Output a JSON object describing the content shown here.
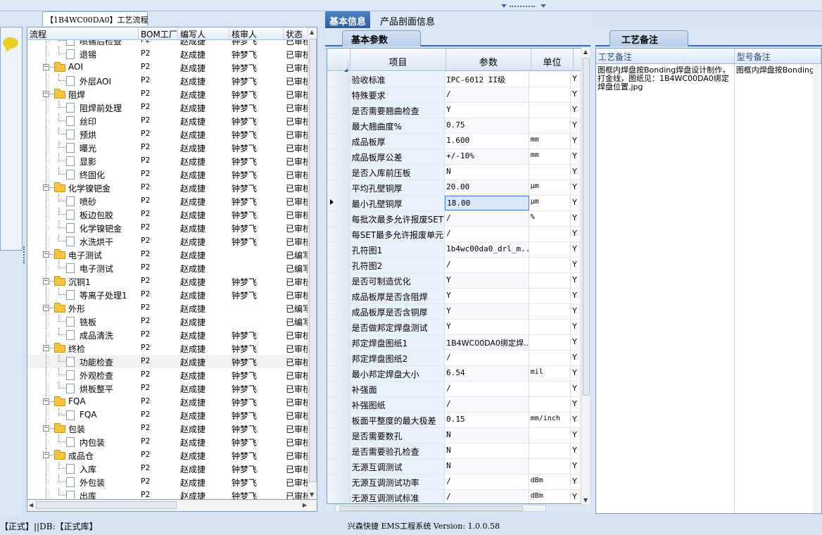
{
  "left_panel": {
    "tab_title": "【1B4WC00DA0】工艺流程",
    "columns": [
      "流程",
      "BOM工厂",
      "编写人",
      "核审人",
      "状态"
    ],
    "rows": [
      {
        "level": 2,
        "type": "item",
        "name": "喷锡后检查",
        "bom": "P2",
        "writer": "赵成捷",
        "reviewer": "钟梦飞",
        "status": "已审核",
        "partial": true
      },
      {
        "level": 2,
        "type": "item",
        "name": "退锡",
        "bom": "P2",
        "writer": "赵成捷",
        "reviewer": "钟梦飞",
        "status": "已审核"
      },
      {
        "level": 1,
        "type": "group",
        "name": "AOI",
        "bom": "P2",
        "writer": "赵成捷",
        "reviewer": "钟梦飞",
        "status": "已审核"
      },
      {
        "level": 2,
        "type": "item",
        "name": "外层AOI",
        "bom": "P2",
        "writer": "赵成捷",
        "reviewer": "钟梦飞",
        "status": "已审核"
      },
      {
        "level": 1,
        "type": "group",
        "name": "阻焊",
        "bom": "P2",
        "writer": "赵成捷",
        "reviewer": "钟梦飞",
        "status": "已审核"
      },
      {
        "level": 2,
        "type": "item",
        "name": "阻焊前处理",
        "bom": "P2",
        "writer": "赵成捷",
        "reviewer": "钟梦飞",
        "status": "已审核"
      },
      {
        "level": 2,
        "type": "item",
        "name": "丝印",
        "bom": "P2",
        "writer": "赵成捷",
        "reviewer": "钟梦飞",
        "status": "已审核"
      },
      {
        "level": 2,
        "type": "item",
        "name": "预烘",
        "bom": "P2",
        "writer": "赵成捷",
        "reviewer": "钟梦飞",
        "status": "已审核"
      },
      {
        "level": 2,
        "type": "item",
        "name": "曝光",
        "bom": "P2",
        "writer": "赵成捷",
        "reviewer": "钟梦飞",
        "status": "已审核"
      },
      {
        "level": 2,
        "type": "item",
        "name": "显影",
        "bom": "P2",
        "writer": "赵成捷",
        "reviewer": "钟梦飞",
        "status": "已审核"
      },
      {
        "level": 2,
        "type": "item",
        "name": "终固化",
        "bom": "P2",
        "writer": "赵成捷",
        "reviewer": "钟梦飞",
        "status": "已审核"
      },
      {
        "level": 1,
        "type": "group",
        "name": "化学镍钯金",
        "bom": "P2",
        "writer": "赵成捷",
        "reviewer": "钟梦飞",
        "status": "已审核"
      },
      {
        "level": 2,
        "type": "item",
        "name": "喷砂",
        "bom": "P2",
        "writer": "赵成捷",
        "reviewer": "钟梦飞",
        "status": "已审核"
      },
      {
        "level": 2,
        "type": "item",
        "name": "板边包胶",
        "bom": "P2",
        "writer": "赵成捷",
        "reviewer": "钟梦飞",
        "status": "已审核"
      },
      {
        "level": 2,
        "type": "item",
        "name": "化学镍钯金",
        "bom": "P2",
        "writer": "赵成捷",
        "reviewer": "钟梦飞",
        "status": "已审核"
      },
      {
        "level": 2,
        "type": "item",
        "name": "水洗烘干",
        "bom": "P2",
        "writer": "赵成捷",
        "reviewer": "钟梦飞",
        "status": "已审核"
      },
      {
        "level": 1,
        "type": "group",
        "name": "电子测试",
        "bom": "P2",
        "writer": "赵成捷",
        "reviewer": "",
        "status": "已编写"
      },
      {
        "level": 2,
        "type": "item",
        "name": "电子测试",
        "bom": "P2",
        "writer": "赵成捷",
        "reviewer": "",
        "status": "已编写"
      },
      {
        "level": 1,
        "type": "group",
        "name": "沉铜1",
        "bom": "P2",
        "writer": "赵成捷",
        "reviewer": "钟梦飞",
        "status": "已审核"
      },
      {
        "level": 2,
        "type": "item",
        "name": "等离子处理1",
        "bom": "P2",
        "writer": "赵成捷",
        "reviewer": "钟梦飞",
        "status": "已审核"
      },
      {
        "level": 1,
        "type": "group",
        "name": "外形",
        "bom": "P2",
        "writer": "赵成捷",
        "reviewer": "",
        "status": "已编写"
      },
      {
        "level": 2,
        "type": "item",
        "name": "铣板",
        "bom": "P2",
        "writer": "赵成捷",
        "reviewer": "",
        "status": "已编写"
      },
      {
        "level": 2,
        "type": "item",
        "name": "成品清洗",
        "bom": "P2",
        "writer": "赵成捷",
        "reviewer": "钟梦飞",
        "status": "已审核"
      },
      {
        "level": 1,
        "type": "group",
        "name": "终检",
        "bom": "P2",
        "writer": "赵成捷",
        "reviewer": "钟梦飞",
        "status": "已审核"
      },
      {
        "level": 2,
        "type": "item",
        "name": "功能检查",
        "bom": "P2",
        "writer": "赵成捷",
        "reviewer": "钟梦飞",
        "status": "已审核",
        "selected": true
      },
      {
        "level": 2,
        "type": "item",
        "name": "外观检查",
        "bom": "P2",
        "writer": "赵成捷",
        "reviewer": "钟梦飞",
        "status": "已审核"
      },
      {
        "level": 2,
        "type": "item",
        "name": "烘板整平",
        "bom": "P2",
        "writer": "赵成捷",
        "reviewer": "钟梦飞",
        "status": "已审核"
      },
      {
        "level": 1,
        "type": "group",
        "name": "FQA",
        "bom": "P2",
        "writer": "赵成捷",
        "reviewer": "钟梦飞",
        "status": "已审核"
      },
      {
        "level": 2,
        "type": "item",
        "name": "FQA",
        "bom": "P2",
        "writer": "赵成捷",
        "reviewer": "钟梦飞",
        "status": "已审核"
      },
      {
        "level": 1,
        "type": "group",
        "name": "包装",
        "bom": "P2",
        "writer": "赵成捷",
        "reviewer": "钟梦飞",
        "status": "已审核"
      },
      {
        "level": 2,
        "type": "item",
        "name": "内包装",
        "bom": "P2",
        "writer": "赵成捷",
        "reviewer": "钟梦飞",
        "status": "已审核"
      },
      {
        "level": 1,
        "type": "group",
        "name": "成品仓",
        "bom": "P2",
        "writer": "赵成捷",
        "reviewer": "钟梦飞",
        "status": "已审核"
      },
      {
        "level": 2,
        "type": "item",
        "name": "入库",
        "bom": "P2",
        "writer": "赵成捷",
        "reviewer": "钟梦飞",
        "status": "已审核"
      },
      {
        "level": 2,
        "type": "item",
        "name": "外包装",
        "bom": "P2",
        "writer": "赵成捷",
        "reviewer": "钟梦飞",
        "status": "已审核"
      },
      {
        "level": 2,
        "type": "item",
        "name": "出库",
        "bom": "P2",
        "writer": "赵成捷",
        "reviewer": "钟梦飞",
        "status": "已审核"
      }
    ]
  },
  "middle_panel": {
    "tabs": [
      "基本信息",
      "产品剖面信息"
    ],
    "subtab": "基本参数",
    "columns": [
      "项目",
      "参数",
      "单位",
      ""
    ],
    "rows": [
      {
        "item": "验收标准",
        "param": "IPC-6012 II级",
        "unit": "",
        "flag": "Y"
      },
      {
        "item": "特殊要求",
        "param": "/",
        "unit": "",
        "flag": "Y"
      },
      {
        "item": "是否需要翘曲检查",
        "param": "Y",
        "unit": "",
        "flag": "Y"
      },
      {
        "item": "最大翘曲度%",
        "param": "0.75",
        "unit": "",
        "flag": "Y"
      },
      {
        "item": "成品板厚",
        "param": "1.600",
        "unit": "mm",
        "flag": "Y"
      },
      {
        "item": "成品板厚公差",
        "param": "+/-10%",
        "unit": "mm",
        "flag": "Y"
      },
      {
        "item": "是否入库前压板",
        "param": "N",
        "unit": "",
        "flag": "Y"
      },
      {
        "item": "平均孔壁铜厚",
        "param": "20.00",
        "unit": "μm",
        "flag": "Y"
      },
      {
        "item": "最小孔壁铜厚",
        "param": "18.00",
        "unit": "μm",
        "flag": "Y",
        "current": true
      },
      {
        "item": "每批次最多允许报废SET",
        "param": "/",
        "unit": "%",
        "flag": "Y"
      },
      {
        "item": "每SET最多允许报废单元",
        "param": "/",
        "unit": "",
        "flag": "Y"
      },
      {
        "item": "孔符图1",
        "param": "1b4wc00da0_drl_m...",
        "unit": "",
        "flag": "Y"
      },
      {
        "item": "孔符图2",
        "param": "/",
        "unit": "",
        "flag": "Y"
      },
      {
        "item": "是否可制造优化",
        "param": "Y",
        "unit": "",
        "flag": "Y"
      },
      {
        "item": "成品板厚是否含阻焊",
        "param": "Y",
        "unit": "",
        "flag": "Y"
      },
      {
        "item": "成品板厚是否含铜厚",
        "param": "Y",
        "unit": "",
        "flag": "Y"
      },
      {
        "item": "是否做邦定焊盘测试",
        "param": "Y",
        "unit": "",
        "flag": "Y"
      },
      {
        "item": "邦定焊盘图纸1",
        "param": "1B4WC00DA0绑定焊...",
        "unit": "",
        "flag": "Y",
        "zh": true
      },
      {
        "item": "邦定焊盘图纸2",
        "param": "/",
        "unit": "",
        "flag": "Y"
      },
      {
        "item": "最小邦定焊盘大小",
        "param": "6.54",
        "unit": "mil",
        "flag": "Y"
      },
      {
        "item": "补强面",
        "param": "/",
        "unit": "",
        "flag": "Y"
      },
      {
        "item": "补强图纸",
        "param": "/",
        "unit": "",
        "flag": "Y"
      },
      {
        "item": "板面平整度的最大极差",
        "param": "0.15",
        "unit": "mm/inch",
        "flag": "Y"
      },
      {
        "item": "是否需要数孔",
        "param": "N",
        "unit": "",
        "flag": "Y"
      },
      {
        "item": "是否需要验孔检查",
        "param": "N",
        "unit": "",
        "flag": "Y"
      },
      {
        "item": "无源互调测试",
        "param": "N",
        "unit": "",
        "flag": "Y"
      },
      {
        "item": "无源互调测试功率",
        "param": "/",
        "unit": "dBm",
        "flag": "Y"
      },
      {
        "item": "无源互调测试标准",
        "param": "/",
        "unit": "dBm",
        "flag": "Y"
      }
    ]
  },
  "right_panel": {
    "tab": "工艺备注",
    "columns": [
      "工艺备注",
      "型号备注"
    ],
    "process_note": "图框内焊盘按Bonding焊盘设计制作，打金线，图纸见：1B4WC00DA0绑定焊盘位置.jpg",
    "model_note": "图框内焊盘按Bonding焊"
  },
  "status_bar": {
    "left": "【正式】||DB:【正式库】",
    "center": "兴森快捷 EMS工程系统 Version: 1.0.0.58"
  },
  "icons": {
    "chat": "speech-bubble-icon",
    "folder": "folder-icon",
    "document": "document-icon"
  },
  "colors": {
    "active_tab": "#3a6cb0",
    "folder": "#f5c342",
    "panel_bg": "#d6e3f3"
  }
}
